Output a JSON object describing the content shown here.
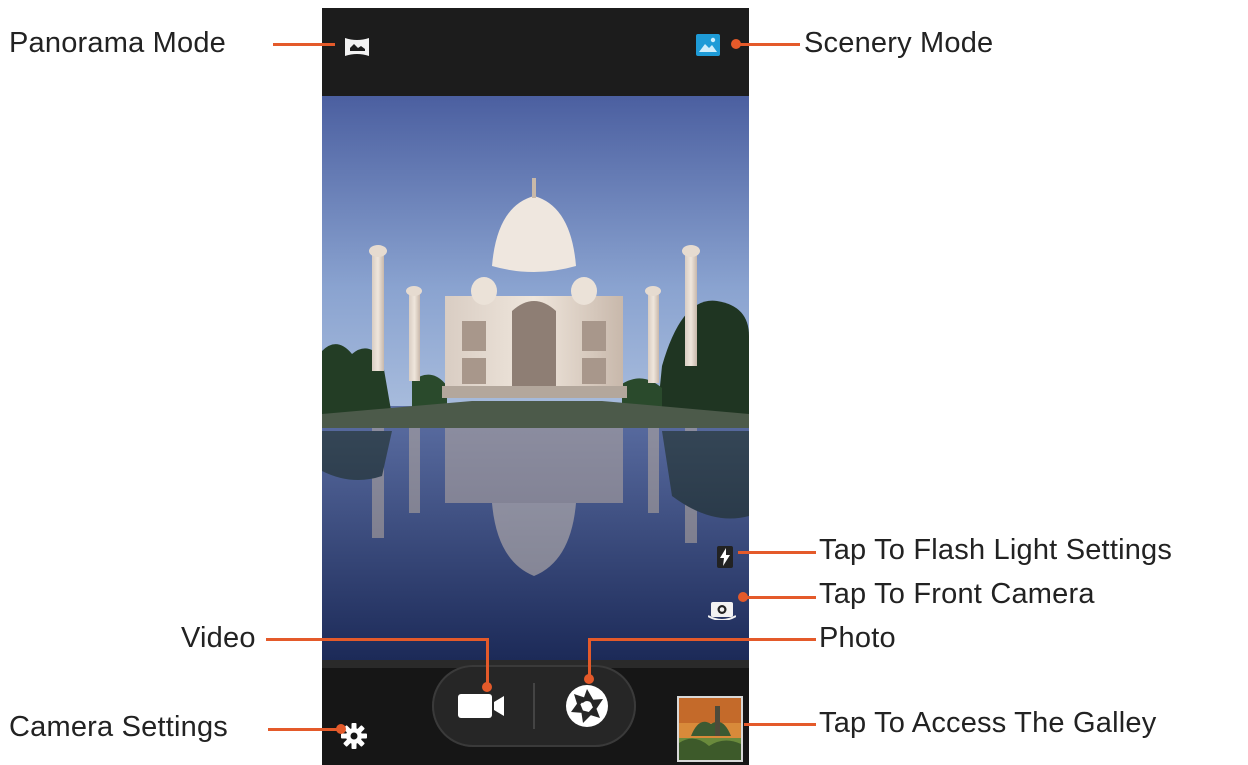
{
  "annotations": {
    "panorama_mode": "Panorama Mode",
    "scenery_mode": "Scenery Mode",
    "flash_settings": "Tap To Flash Light Settings",
    "front_camera": "Tap To Front Camera",
    "video": "Video",
    "photo": "Photo",
    "camera_settings": "Camera Settings",
    "gallery": "Tap To Access The Galley"
  },
  "icons": {
    "panorama": "panorama-icon",
    "scenery": "scenery-icon",
    "flash": "flash-icon",
    "switch_camera": "switch-camera-icon",
    "video": "video-camera-icon",
    "shutter": "shutter-icon",
    "settings": "gear-icon",
    "gallery": "gallery-thumbnail"
  },
  "colors": {
    "leader_line": "#e45a2a",
    "scenery_accent": "#1e9bd7",
    "phone_background": "#1b1b1b"
  }
}
